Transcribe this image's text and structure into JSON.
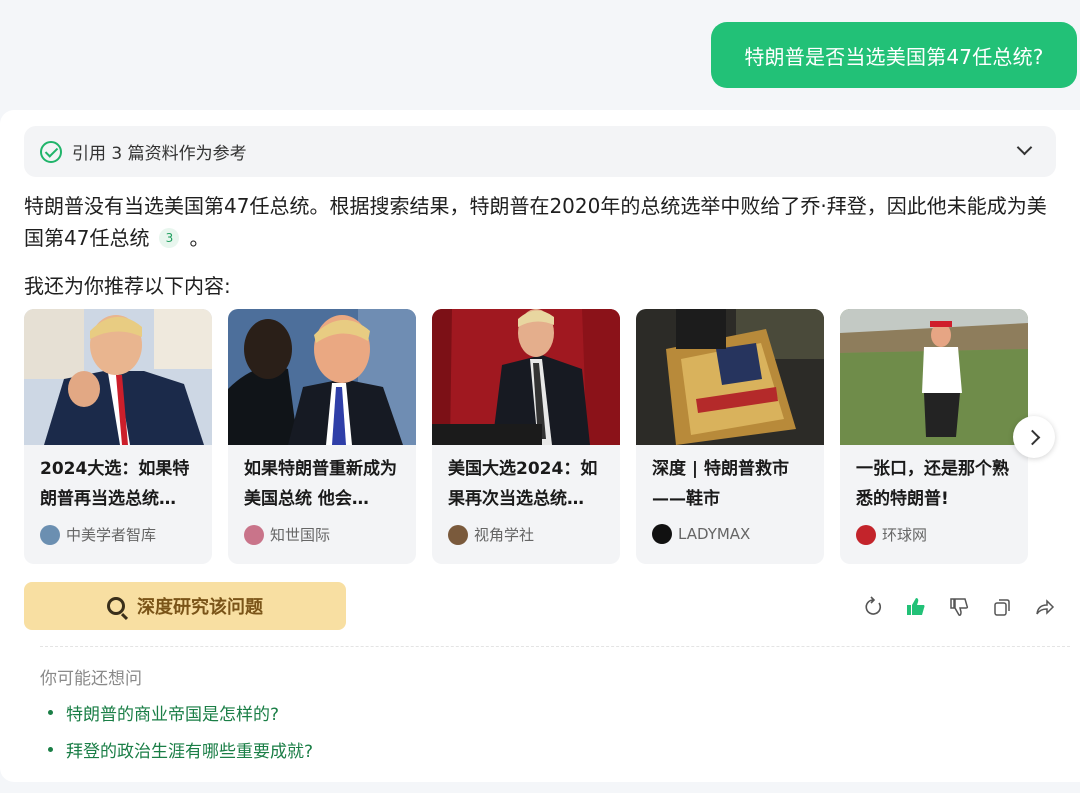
{
  "user_message": "特朗普是否当选美国第47任总统?",
  "references": {
    "label": "引用 3 篇资料作为参考"
  },
  "answer": {
    "text": "特朗普没有当选美国第47任总统。根据搜索结果，特朗普在2020年的总统选举中败给了乔·拜登，因此他未能成为美国第47任总统",
    "citation": "3",
    "tail": "。"
  },
  "recommend_title": "我还为你推荐以下内容:",
  "cards": [
    {
      "title": "2024大选：如果特朗普再当选总统…",
      "source": "中美学者智库"
    },
    {
      "title": "如果特朗普重新成为美国总统 他会…",
      "source": "知世国际"
    },
    {
      "title": "美国大选2024：如果再次当选总统…",
      "source": "视角学社"
    },
    {
      "title": "深度 | 特朗普救市——鞋市",
      "source": "LADYMAX"
    },
    {
      "title": "一张口，还是那个熟悉的特朗普!",
      "source": "环球网"
    }
  ],
  "deep_research": "深度研究该问题",
  "icons": [
    "refresh-icon",
    "thumbs-up-icon",
    "thumbs-down-icon",
    "copy-icon",
    "share-icon"
  ],
  "suggestions": {
    "title": "你可能还想问",
    "items": [
      "特朗普的商业帝国是怎样的?",
      "拜登的政治生涯有哪些重要成就?"
    ]
  },
  "colors": {
    "accent": "#22c177",
    "link": "#1a7e46",
    "deep_bg": "#f8dfa2"
  }
}
